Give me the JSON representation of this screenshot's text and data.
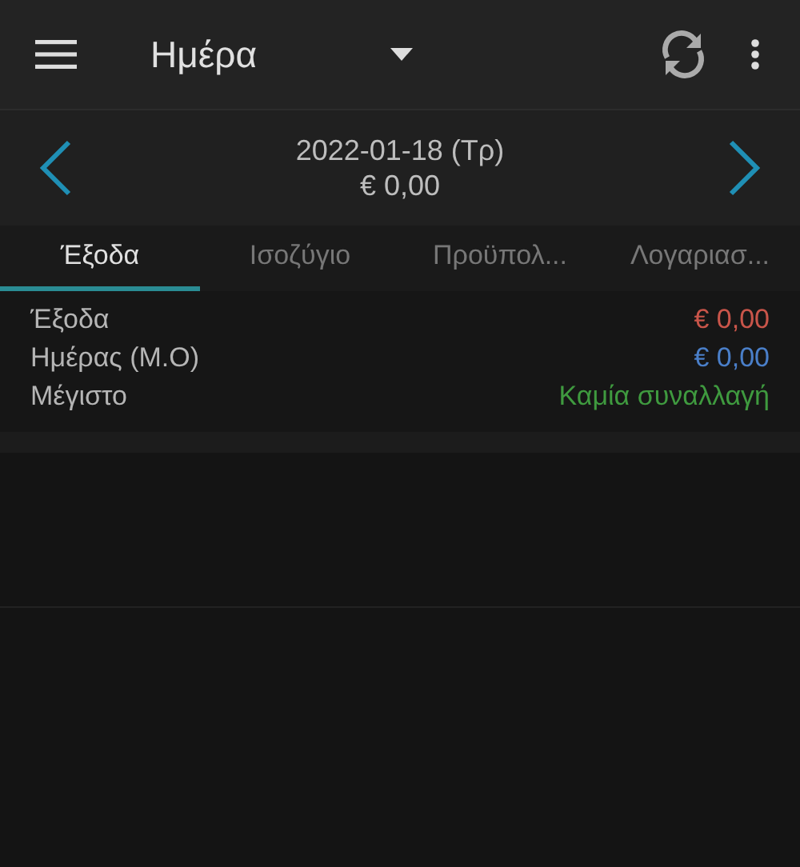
{
  "toolbar": {
    "title": "Ημέρα"
  },
  "date_nav": {
    "date": "2022-01-18 (Τρ)",
    "total": "€ 0,00"
  },
  "tabs": [
    {
      "label": "Έξοδα",
      "selected": true
    },
    {
      "label": "Ισοζύγιο",
      "selected": false
    },
    {
      "label": "Προϋπολ...",
      "selected": false
    },
    {
      "label": "Λογαριασ...",
      "selected": false
    }
  ],
  "summary": [
    {
      "label": "Έξοδα",
      "value": "€ 0,00",
      "color": "#c9554a"
    },
    {
      "label": "Ημέρας (Μ.Ο)",
      "value": "€ 0,00",
      "color": "#4a7fc9"
    },
    {
      "label": "Μέγιστο",
      "value": "Καμία συναλλαγή",
      "color": "#3f9a3f"
    }
  ]
}
